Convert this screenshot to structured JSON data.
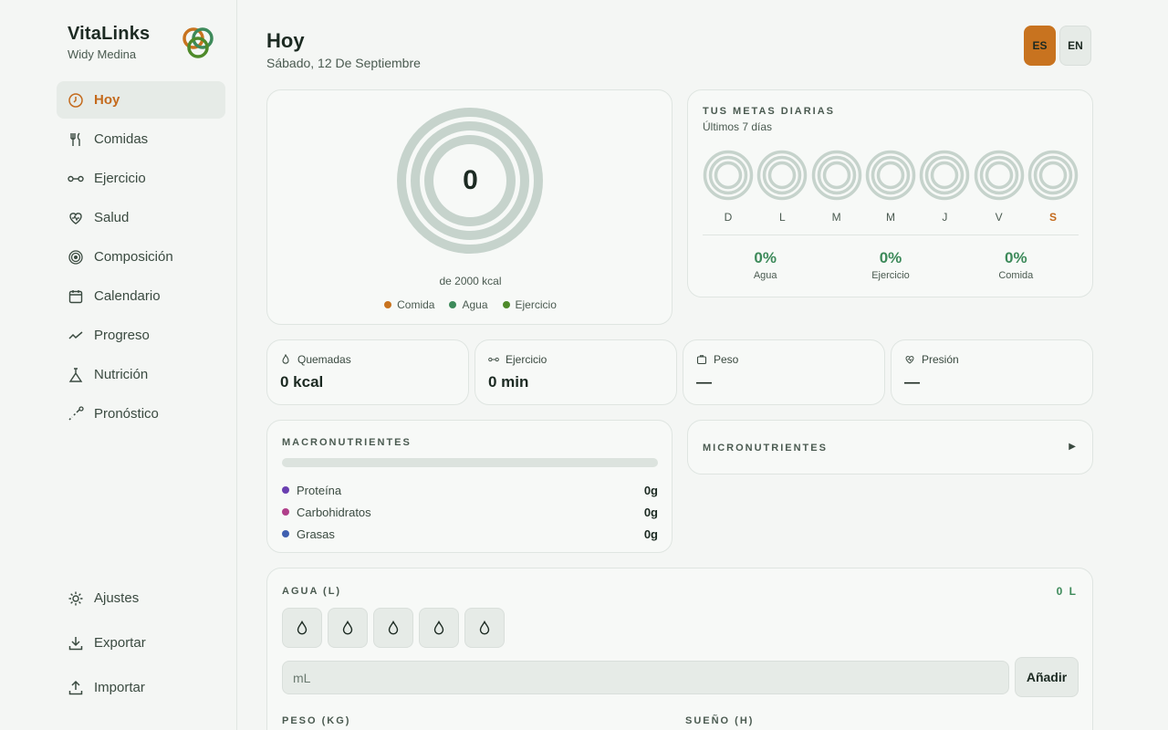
{
  "app": {
    "name": "VitaLinks",
    "user": "Widy Medina"
  },
  "nav": [
    {
      "label": "Hoy",
      "icon": "clock-icon",
      "active": true
    },
    {
      "label": "Comidas",
      "icon": "utensils-icon"
    },
    {
      "label": "Ejercicio",
      "icon": "dumbbell-icon"
    },
    {
      "label": "Salud",
      "icon": "heart-icon"
    },
    {
      "label": "Composición",
      "icon": "target-icon"
    },
    {
      "label": "Calendario",
      "icon": "calendar-icon"
    },
    {
      "label": "Progreso",
      "icon": "trend-icon"
    },
    {
      "label": "Nutrición",
      "icon": "flask-icon"
    },
    {
      "label": "Pronóstico",
      "icon": "forecast-icon"
    }
  ],
  "nav_bottom": [
    {
      "label": "Ajustes",
      "icon": "gear-icon"
    },
    {
      "label": "Exportar",
      "icon": "download-icon"
    },
    {
      "label": "Importar",
      "icon": "upload-icon"
    }
  ],
  "header": {
    "title": "Hoy",
    "date": "Sábado, 12 De Septiembre"
  },
  "lang": {
    "es": "ES",
    "en": "EN",
    "selected": "ES"
  },
  "calories": {
    "value": "0",
    "goal_text": "de 2000 kcal",
    "legend": [
      {
        "label": "Comida",
        "color": "#c8731f"
      },
      {
        "label": "Agua",
        "color": "#3d8a5a"
      },
      {
        "label": "Ejercicio",
        "color": "#4e8a2a"
      }
    ]
  },
  "goals": {
    "title": "Tus metas diarias",
    "subtitle": "Últimos 7 días",
    "days": [
      "D",
      "L",
      "M",
      "M",
      "J",
      "V",
      "S"
    ],
    "today_index": 6,
    "stats": [
      {
        "pct": "0%",
        "label": "Agua"
      },
      {
        "pct": "0%",
        "label": "Ejercicio"
      },
      {
        "pct": "0%",
        "label": "Comida"
      }
    ]
  },
  "stats": [
    {
      "label": "Quemadas",
      "value": "0 kcal",
      "icon": "flame-icon"
    },
    {
      "label": "Ejercicio",
      "value": "0 min",
      "icon": "dumbbell-icon"
    },
    {
      "label": "Peso",
      "value": "—",
      "icon": "scale-icon"
    },
    {
      "label": "Presión",
      "value": "—",
      "icon": "heart-icon"
    }
  ],
  "macros": {
    "title": "Macronutrientes",
    "items": [
      {
        "label": "Proteína",
        "value": "0g",
        "color": "#6a3fb0"
      },
      {
        "label": "Carbohidratos",
        "value": "0g",
        "color": "#b03f8a"
      },
      {
        "label": "Grasas",
        "value": "0g",
        "color": "#3f5fb0"
      }
    ]
  },
  "micros": {
    "title": "Micronutrientes",
    "arrow": "▶"
  },
  "water": {
    "title": "Agua (L)",
    "total": "0 L",
    "cups_count": 5,
    "input_placeholder": "mL",
    "add_label": "Añadir"
  },
  "peso": {
    "title": "Peso (kg)"
  },
  "sueno": {
    "title": "Sueño (h)"
  }
}
